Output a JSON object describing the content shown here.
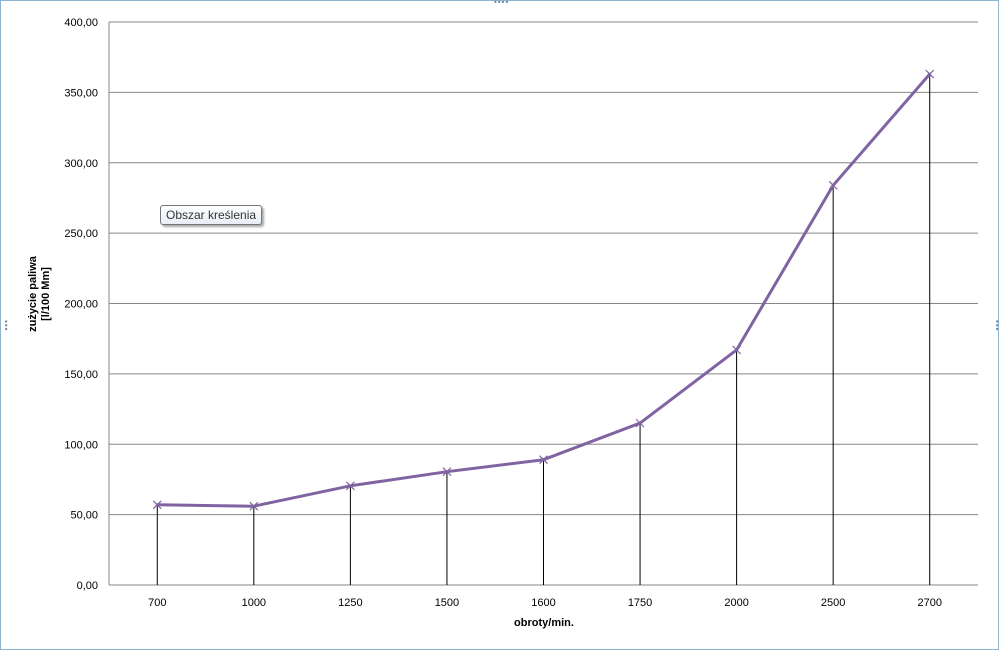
{
  "tooltip": {
    "text": "Obszar kreślenia"
  },
  "colors": {
    "series_line": "#8064a2",
    "gridline": "#868686",
    "drop_line": "#000000",
    "frame_border": "#8eb4cf"
  },
  "chart_data": {
    "type": "line",
    "title": "",
    "xlabel": "obroty/min.",
    "ylabel_lines": [
      "zużycie paliwa",
      "[l/100 Mm]"
    ],
    "categories": [
      "700",
      "1000",
      "1250",
      "1500",
      "1600",
      "1750",
      "2000",
      "2500",
      "2700"
    ],
    "series": [
      {
        "values": [
          57.0,
          56.0,
          70.5,
          80.5,
          89.0,
          115.0,
          167.0,
          284.0,
          363.0
        ]
      }
    ],
    "ylim": [
      0,
      400
    ],
    "yticks": [
      0,
      50,
      100,
      150,
      200,
      250,
      300,
      350,
      400
    ],
    "ytick_labels": [
      "0,00",
      "50,00",
      "100,00",
      "150,00",
      "200,00",
      "250,00",
      "300,00",
      "350,00",
      "400,00"
    ],
    "grid": true,
    "drop_lines": true,
    "marker": "x",
    "legend": "none"
  }
}
